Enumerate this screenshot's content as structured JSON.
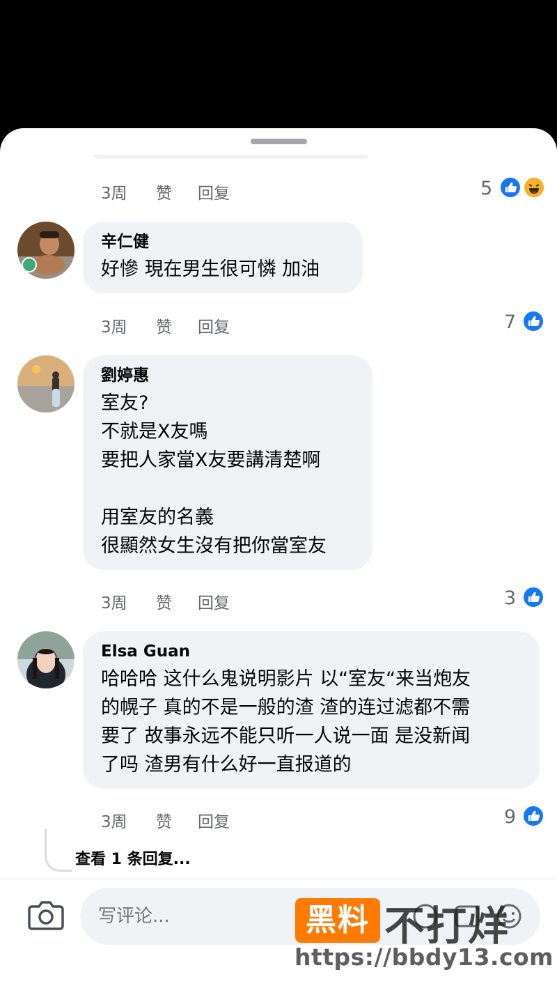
{
  "common": {
    "like_label": "赞",
    "reply_label": "回复"
  },
  "comments": [
    {
      "time": "3周",
      "reaction_count": "5",
      "reactions": [
        "like",
        "haha"
      ]
    },
    {
      "author": "辛仁健",
      "text": "好慘 現在男生很可憐 加油",
      "time": "3周",
      "reaction_count": "7",
      "reactions": [
        "like"
      ]
    },
    {
      "author": "劉婷惠",
      "text": "室友?\n不就是X友嗎\n要把人家當X友要講清楚啊\n\n用室友的名義\n很顯然女生沒有把你當室友",
      "time": "3周",
      "reaction_count": "3",
      "reactions": [
        "like"
      ]
    },
    {
      "author": "Elsa Guan",
      "text": "哈哈哈 这什么鬼说明影片 以“室友“来当炮友\n的幌子 真的不是一般的渣 渣的连过滤都不需\n要了 故事永远不能只听一人说一面 是没新闻\n了吗 渣男有什么好一直报道的",
      "time": "3周",
      "reaction_count": "9",
      "reactions": [
        "like"
      ],
      "view_replies": "查看 1 条回复..."
    }
  ],
  "composer": {
    "placeholder": "写评论..."
  },
  "watermark": {
    "badge": "黑料",
    "text": "不打烊",
    "url": "https://bbdy13.com"
  },
  "colors": {
    "accent": "#1877f2",
    "bubble": "#f0f2f5",
    "meta_text": "#65676b",
    "watermark_badge": "#ff7a00"
  },
  "icons": [
    "camera-icon",
    "like-reaction-icon",
    "haha-reaction-icon",
    "sticker-icon",
    "gif-icon",
    "emoji-icon"
  ]
}
